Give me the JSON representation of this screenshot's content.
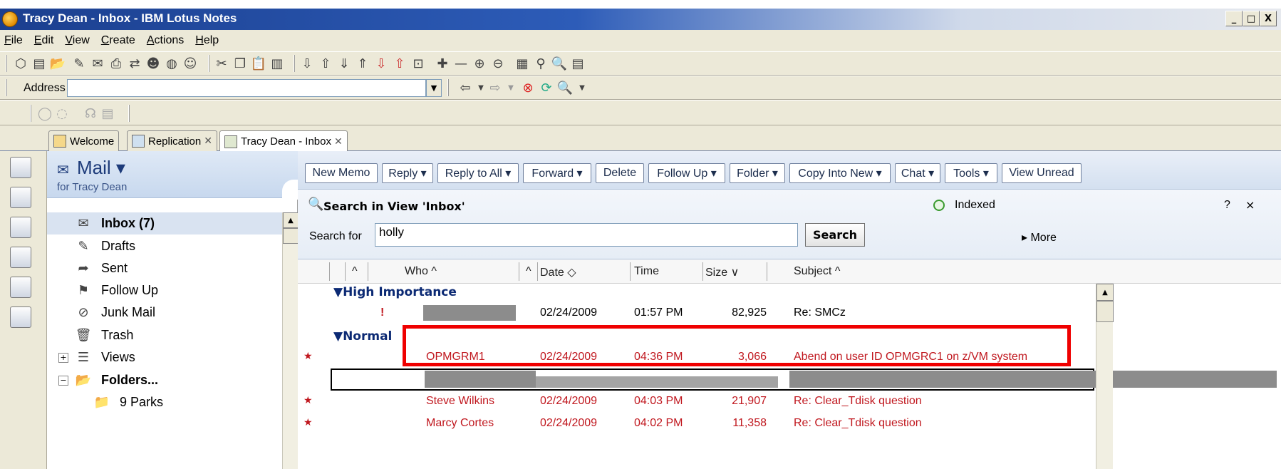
{
  "window": {
    "title": "Tracy Dean - Inbox - IBM Lotus Notes",
    "controls": [
      "_",
      "□",
      "X"
    ]
  },
  "menu": [
    {
      "label": "File",
      "accel": "F",
      "rest": "ile"
    },
    {
      "label": "Edit",
      "accel": "E",
      "rest": "dit"
    },
    {
      "label": "View",
      "accel": "V",
      "rest": "iew"
    },
    {
      "label": "Create",
      "accel": "C",
      "rest": "reate"
    },
    {
      "label": "Actions",
      "accel": "A",
      "rest": "ctions"
    },
    {
      "label": "Help",
      "accel": "H",
      "rest": "elp"
    }
  ],
  "address": {
    "label": "Address",
    "value": ""
  },
  "tabs": [
    {
      "label": "Welcome"
    },
    {
      "label": "Replication"
    },
    {
      "label": "Tracy Dean - Inbox"
    }
  ],
  "navigator": {
    "title": "Mail ▾",
    "subtitle": "for Tracy Dean",
    "items": [
      {
        "label": "Inbox (7)",
        "icon": "inbox-icon",
        "glyph": "✉"
      },
      {
        "label": "Drafts",
        "icon": "drafts-icon",
        "glyph": "✎"
      },
      {
        "label": "Sent",
        "icon": "sent-icon",
        "glyph": "➦"
      },
      {
        "label": "Follow Up",
        "icon": "follow-up-icon",
        "glyph": "⚑"
      },
      {
        "label": "Junk Mail",
        "icon": "junk-mail-icon",
        "glyph": "⊘"
      },
      {
        "label": "Trash",
        "icon": "trash-icon",
        "glyph": "🗑"
      },
      {
        "label": "Views",
        "icon": "views-icon",
        "glyph": "☰"
      },
      {
        "label": "Folders...",
        "icon": "folder-icon",
        "glyph": "📂"
      },
      {
        "label": "9 Parks",
        "icon": "folder-icon",
        "glyph": "📁"
      }
    ]
  },
  "actions": [
    "New Memo",
    "Reply ▾",
    "Reply to All ▾",
    "Forward ▾",
    "Delete",
    "Follow Up ▾",
    "Folder ▾",
    "Copy Into New ▾",
    "Chat ▾",
    "Tools ▾",
    "View Unread"
  ],
  "search": {
    "title": "Search in View 'Inbox'",
    "indexed": "Indexed",
    "help": "?",
    "close": "×",
    "label": "Search for",
    "value": "holly",
    "button": "Search",
    "more": "▸ More"
  },
  "columns": {
    "sort_indicator": "^",
    "who": "Who ^",
    "date": "Date ◇",
    "time": "Time",
    "size": "Size ∨",
    "subject": "Subject ^"
  },
  "categories": {
    "high": "▼High Importance",
    "normal": "▼Normal"
  },
  "rows": [
    {
      "who": "",
      "date": "02/24/2009",
      "time": "01:57 PM",
      "size": "82,925",
      "subject": "Re: SMCz",
      "unread": false,
      "important": "!"
    },
    {
      "who": "OPMGRM1",
      "date": "02/24/2009",
      "time": "04:36 PM",
      "size": "3,066",
      "subject": "Abend on user ID OPMGRC1 on z/VM system",
      "unread": true
    },
    {
      "who": "",
      "date": "",
      "time": "",
      "size": "",
      "subject": "",
      "unread": false
    },
    {
      "who": "Steve Wilkins",
      "date": "02/24/2009",
      "time": "04:03 PM",
      "size": "21,907",
      "subject": "Re: Clear_Tdisk question",
      "unread": true
    },
    {
      "who": "Marcy Cortes",
      "date": "02/24/2009",
      "time": "04:02 PM",
      "size": "11,358",
      "subject": "Re: Clear_Tdisk question",
      "unread": true
    }
  ],
  "colors": {
    "unread": "#c0171e",
    "category": "#0c2a74",
    "highlight": "#ef0000"
  }
}
